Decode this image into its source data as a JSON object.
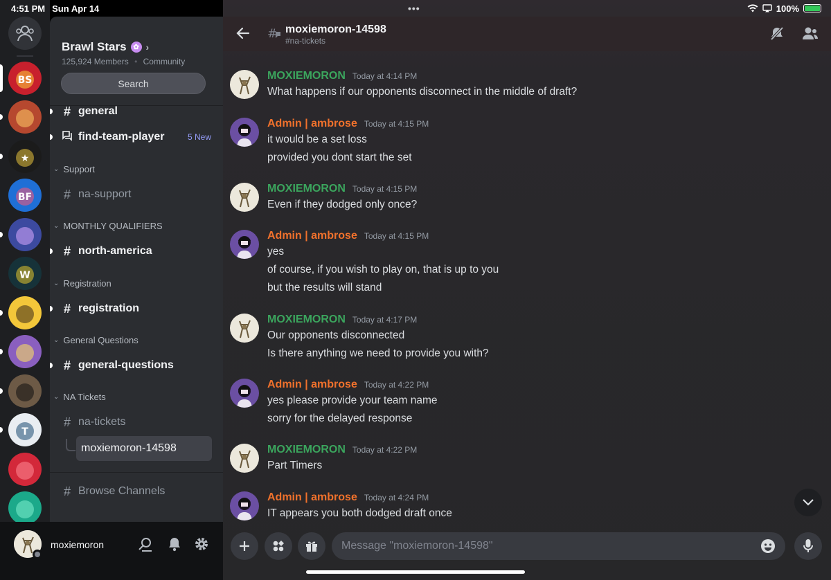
{
  "status": {
    "time": "4:51 PM",
    "date": "Sun Apr 14",
    "battery": "100%"
  },
  "rail": {
    "servers": [
      {
        "name": "Brawl Stars Championship",
        "color": "#c8202d",
        "fg": "#ffd23a",
        "glyph": "BS"
      },
      {
        "name": "Brawler avatar server",
        "color": "#b6482f",
        "fg": "#ffcc66",
        "glyph": ""
      },
      {
        "name": "Brawl Hub",
        "color": "#1b1b1b",
        "fg": "#e8c33c",
        "glyph": "★"
      },
      {
        "name": "Brawl Friends",
        "color": "#1f6fd6",
        "fg": "#ff5577",
        "glyph": "BF"
      },
      {
        "name": "Art server",
        "color": "#3c4aa0",
        "fg": "#d9a7ff",
        "glyph": ""
      },
      {
        "name": "Tournament server",
        "color": "#163239",
        "fg": "#e6c62d",
        "glyph": "W"
      },
      {
        "name": "Monkey server",
        "color": "#f3c73a",
        "fg": "#3b2a1a",
        "glyph": ""
      },
      {
        "name": "Pink server",
        "color": "#8a5fbf",
        "fg": "#ffe45c",
        "glyph": ""
      },
      {
        "name": "Photo server",
        "color": "#6d5a46",
        "fg": "#111",
        "glyph": ""
      },
      {
        "name": "Team server",
        "color": "#e9edf2",
        "fg": "#1b4b73",
        "glyph": "T"
      },
      {
        "name": "Red server",
        "color": "#d3283a",
        "fg": "#ff8a95",
        "glyph": ""
      },
      {
        "name": "Teal server",
        "color": "#1ba98a",
        "fg": "#7ff0d0",
        "glyph": ""
      }
    ]
  },
  "server": {
    "name": "Brawl Stars",
    "members": "125,924 Members",
    "type": "Community",
    "search_label": "Search"
  },
  "channels": {
    "general": "general",
    "find_team": "find-team-player",
    "find_team_badge": "5 New",
    "cat_support": "Support",
    "na_support": "na-support",
    "cat_monthly": "MONTHLY QUALIFIERS",
    "north_america": "north-america",
    "cat_registration": "Registration",
    "registration": "registration",
    "cat_general_q": "General Questions",
    "general_questions": "general-questions",
    "cat_na_tickets": "NA Tickets",
    "na_tickets": "na-tickets",
    "thread": "moxiemoron-14598",
    "browse": "Browse Channels"
  },
  "user": {
    "name": "moxiemoron"
  },
  "header": {
    "title": "moxiemoron-14598",
    "subtitle": "#na-tickets"
  },
  "colors": {
    "user_color": "#3ba55d",
    "admin_color": "#f0712c"
  },
  "messages": [
    {
      "author": "MOXIEMORON",
      "role": "user",
      "time": "Today at 4:14 PM",
      "lines": [
        "What happens if our opponents disconnect in the middle of draft?"
      ]
    },
    {
      "author": "Admin | ambrose",
      "role": "admin",
      "time": "Today at 4:15 PM",
      "lines": [
        "it would be a set loss",
        "provided you dont start the set"
      ]
    },
    {
      "author": "MOXIEMORON",
      "role": "user",
      "time": "Today at 4:15 PM",
      "lines": [
        "Even if they dodged only once?"
      ]
    },
    {
      "author": "Admin | ambrose",
      "role": "admin",
      "time": "Today at 4:15 PM",
      "lines": [
        "yes",
        "of course, if you wish to play on, that is up to you",
        "but the results will stand"
      ]
    },
    {
      "author": "MOXIEMORON",
      "role": "user",
      "time": "Today at 4:17 PM",
      "lines": [
        "Our opponents disconnected",
        "Is there anything we need to provide you with?"
      ]
    },
    {
      "author": "Admin | ambrose",
      "role": "admin",
      "time": "Today at 4:22 PM",
      "lines": [
        "yes please provide your team name",
        "sorry for the delayed response"
      ]
    },
    {
      "author": "MOXIEMORON",
      "role": "user",
      "time": "Today at 4:22 PM",
      "lines": [
        "Part Timers"
      ]
    },
    {
      "author": "Admin | ambrose",
      "role": "admin",
      "time": "Today at 4:24 PM",
      "lines": [
        "IT appears you both dodged draft once"
      ]
    }
  ],
  "composer": {
    "placeholder": "Message \"moxiemoron-14598\""
  }
}
